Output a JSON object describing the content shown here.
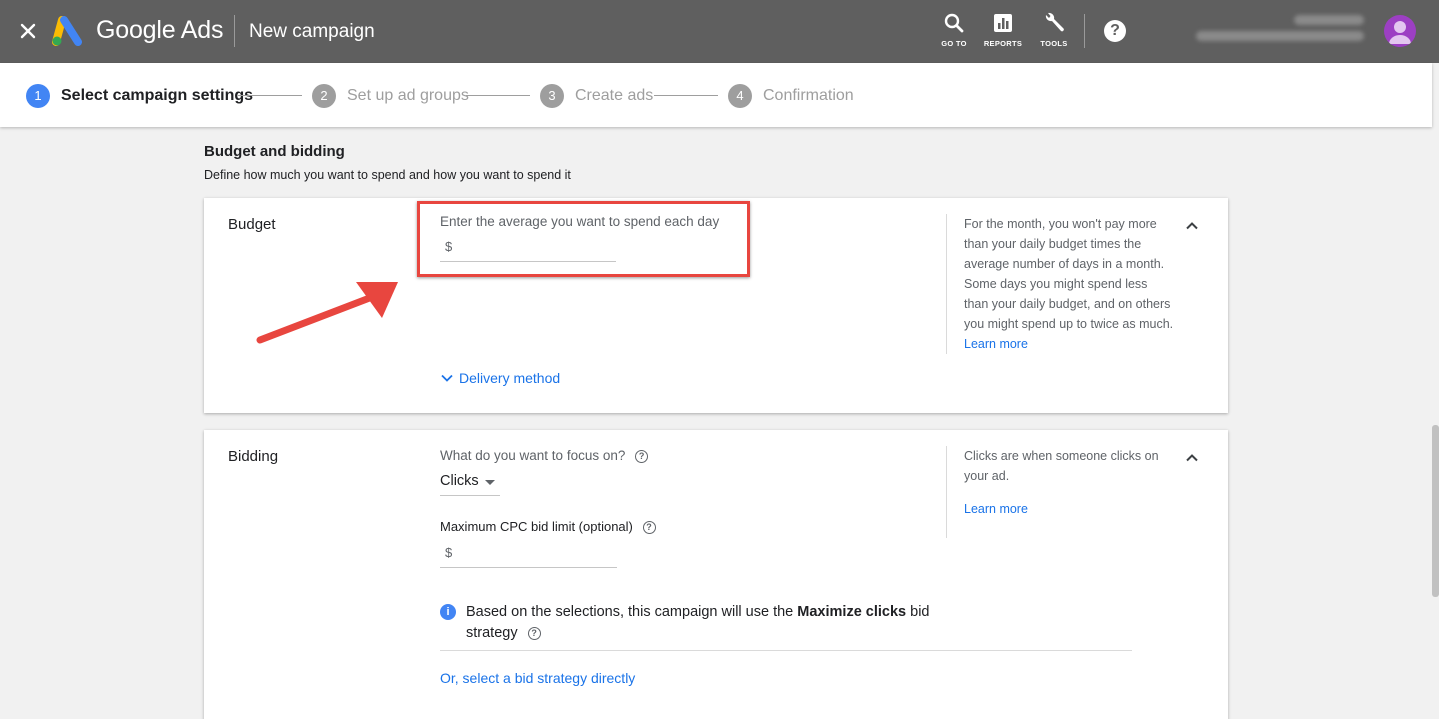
{
  "header": {
    "brand": "Google Ads",
    "page_title": "New campaign",
    "tools": [
      {
        "label": "GO TO",
        "icon": "search-icon"
      },
      {
        "label": "REPORTS",
        "icon": "reports-icon"
      },
      {
        "label": "TOOLS",
        "icon": "wrench-icon"
      }
    ],
    "help_glyph": "?"
  },
  "stepper": {
    "steps": [
      {
        "num": "1",
        "label": "Select campaign settings",
        "active": true
      },
      {
        "num": "2",
        "label": "Set up ad groups",
        "active": false
      },
      {
        "num": "3",
        "label": "Create ads",
        "active": false
      },
      {
        "num": "4",
        "label": "Confirmation",
        "active": false
      }
    ]
  },
  "section": {
    "title": "Budget and bidding",
    "subtitle": "Define how much you want to spend and how you want to spend it"
  },
  "budget": {
    "label": "Budget",
    "input_label": "Enter the average you want to spend each day",
    "currency": "$",
    "value": "",
    "delivery_link": "Delivery method",
    "help_text": "For the month, you won't pay more than your daily budget times the average number of days in a month. Some days you might spend less than your daily budget, and on others you might spend up to twice as much.",
    "help_link": "Learn more"
  },
  "bidding": {
    "label": "Bidding",
    "focus_label": "What do you want to focus on?",
    "focus_value": "Clicks",
    "cpc_label": "Maximum CPC bid limit (optional)",
    "currency": "$",
    "cpc_value": "",
    "info_prefix": "Based on the selections, this campaign will use the ",
    "info_bold": "Maximize clicks",
    "info_suffix": " bid strategy",
    "select_link": "Or, select a bid strategy directly",
    "help_text": "Clicks are when someone clicks on your ad.",
    "help_link": "Learn more"
  },
  "colors": {
    "topbar": "#5f5f5f",
    "accent": "#4285f4",
    "link": "#1a73e8",
    "annotation": "#e8463f",
    "avatar": "#9c3fc3"
  }
}
